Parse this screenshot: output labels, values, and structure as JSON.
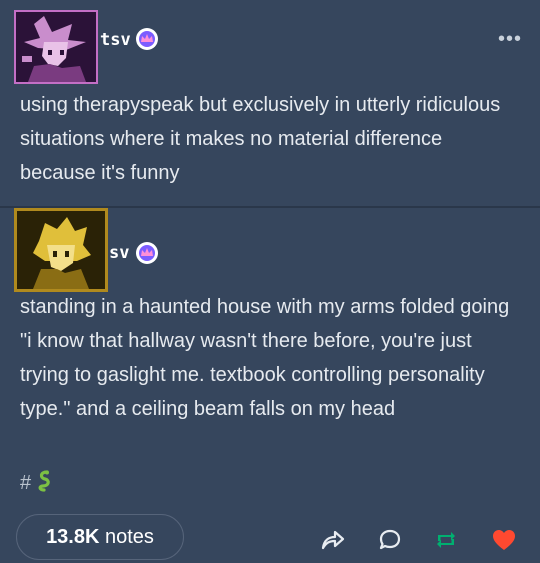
{
  "posts": [
    {
      "username": "tsv",
      "text": "using therapyspeak but exclusively in utterly ridiculous situations where it makes no material difference because it's funny",
      "more_label": "•••"
    },
    {
      "username": "sv",
      "text": "standing in a haunted house with my arms folded going \"i know that hallway wasn't there before, you're just trying to gaslight me. textbook controlling personality type.\" and a ceiling beam falls on my head",
      "tag": "#",
      "tag_emoji": "snake-emoji"
    }
  ],
  "footer": {
    "notes_count": "13.8K",
    "notes_label": "notes",
    "actions": [
      "share-icon",
      "reply-icon",
      "reblog-icon",
      "like-icon"
    ]
  },
  "colors": {
    "background": "#36465d",
    "avatar1_border": "#c46fc6",
    "avatar2_border": "#b08a1e",
    "reblog": "#00b070",
    "like": "#ff4930"
  }
}
